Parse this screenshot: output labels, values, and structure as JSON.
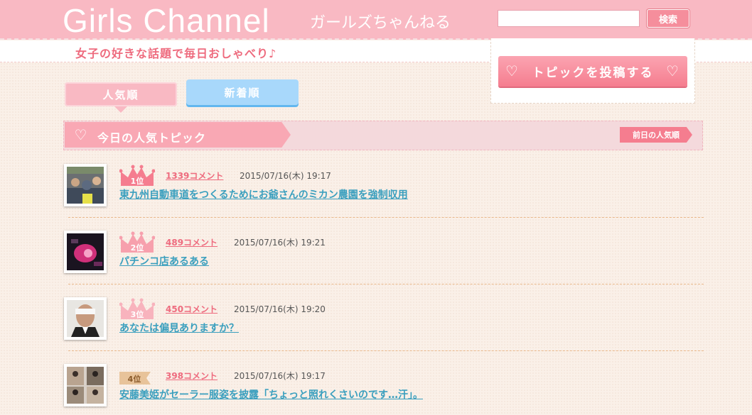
{
  "header": {
    "logo": "Girls Channel",
    "logo_sub": "ガールズちゃんねる",
    "tagline": "女子の好きな話題で毎日おしゃべり♪",
    "search": {
      "placeholder": "",
      "button_label": "検索"
    },
    "post_button_label": "トピックを投稿する"
  },
  "tabs": [
    {
      "label": "人気順",
      "active": true
    },
    {
      "label": "新着順",
      "active": false
    }
  ],
  "section": {
    "title": "今日の人気トピック",
    "prev_label": "前日の人気順"
  },
  "topics": [
    {
      "rank": "1位",
      "comments": "1339コメント",
      "date": "2015/07/16(木) 19:17",
      "title": "東九州自動車道をつくるためにお爺さんのミカン農園を強制収用",
      "crown_color": "#f57d8f"
    },
    {
      "rank": "2位",
      "comments": "489コメント",
      "date": "2015/07/16(木) 19:21",
      "title": "パチンコ店あるある",
      "crown_color": "#f7a0ad"
    },
    {
      "rank": "3位",
      "comments": "450コメント",
      "date": "2015/07/16(木) 19:20",
      "title": "あなたは偏見ありますか？",
      "crown_color": "#f8b3bd"
    },
    {
      "rank": "4位",
      "comments": "398コメント",
      "date": "2015/07/16(木) 19:17",
      "title": "安藤美姫がセーラー服姿を披露「ちょっと照れくさいのです…汗」。",
      "crown_color": "#e8c39a"
    }
  ],
  "colors": {
    "header_pink": "#f9b9c3",
    "accent_pink": "#f57d8f",
    "link_blue": "#3a9fbe",
    "tab_blue": "#a8d8fb"
  }
}
